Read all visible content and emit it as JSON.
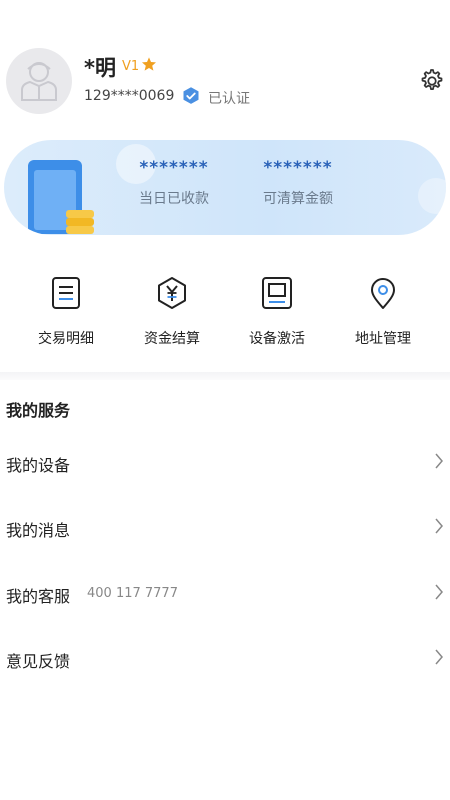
{
  "profile": {
    "name": "*明",
    "level": "V1",
    "phone": "129****0069",
    "verified_label": "已认证"
  },
  "summary": {
    "today_received_value": "*******",
    "today_received_label": "当日已收款",
    "settleable_value": "*******",
    "settleable_label": "可清算金额"
  },
  "actions": [
    {
      "label": "交易明细",
      "icon": "transaction-list-icon"
    },
    {
      "label": "资金结算",
      "icon": "yuan-settlement-icon"
    },
    {
      "label": "设备激活",
      "icon": "device-activate-icon"
    },
    {
      "label": "地址管理",
      "icon": "location-pin-icon"
    }
  ],
  "services": {
    "title": "我的服务",
    "items": [
      {
        "label": "我的设备"
      },
      {
        "label": "我的消息"
      },
      {
        "label": "我的客服",
        "extra": "400 117 7777"
      },
      {
        "label": "意见反馈"
      }
    ]
  },
  "colors": {
    "accent": "#2a62b8",
    "level": "#f0a020",
    "card_bg": "#d4e8fb",
    "verify_badge": "#4a90e2"
  }
}
